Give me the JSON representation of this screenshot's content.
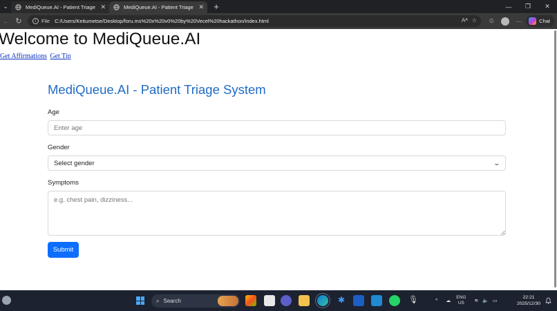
{
  "browser": {
    "tabs": [
      {
        "title": "MediQueue.AI - Patient Triage",
        "active": false
      },
      {
        "title": "MediQueue.AI - Patient Triage",
        "active": true
      }
    ],
    "address": {
      "scheme": "File",
      "url": "C:/Users/Keitumetse/Desktop/foru.ms%20x%20v0%20by%20Vecel%20hackathon/Index.html"
    },
    "chat_label": "Chat"
  },
  "page": {
    "welcome_heading": "Welcome to MediQueue.AI",
    "links": [
      "Get Affirmations",
      "Get Tip"
    ],
    "form": {
      "title": "MediQueue.AI - Patient Triage System",
      "age_label": "Age",
      "age_placeholder": "Enter age",
      "gender_label": "Gender",
      "gender_selected": "Select gender",
      "symptoms_label": "Symptoms",
      "symptoms_placeholder": "e.g. chest pain, dizziness...",
      "submit_label": "Submit"
    }
  },
  "taskbar": {
    "search_label": "Search",
    "lang_top": "ENG",
    "lang_bottom": "US",
    "time": "22:21",
    "date": "2025/12/30",
    "colors": {
      "accent": "#0d6efd",
      "title": "#1f6bc7"
    }
  }
}
